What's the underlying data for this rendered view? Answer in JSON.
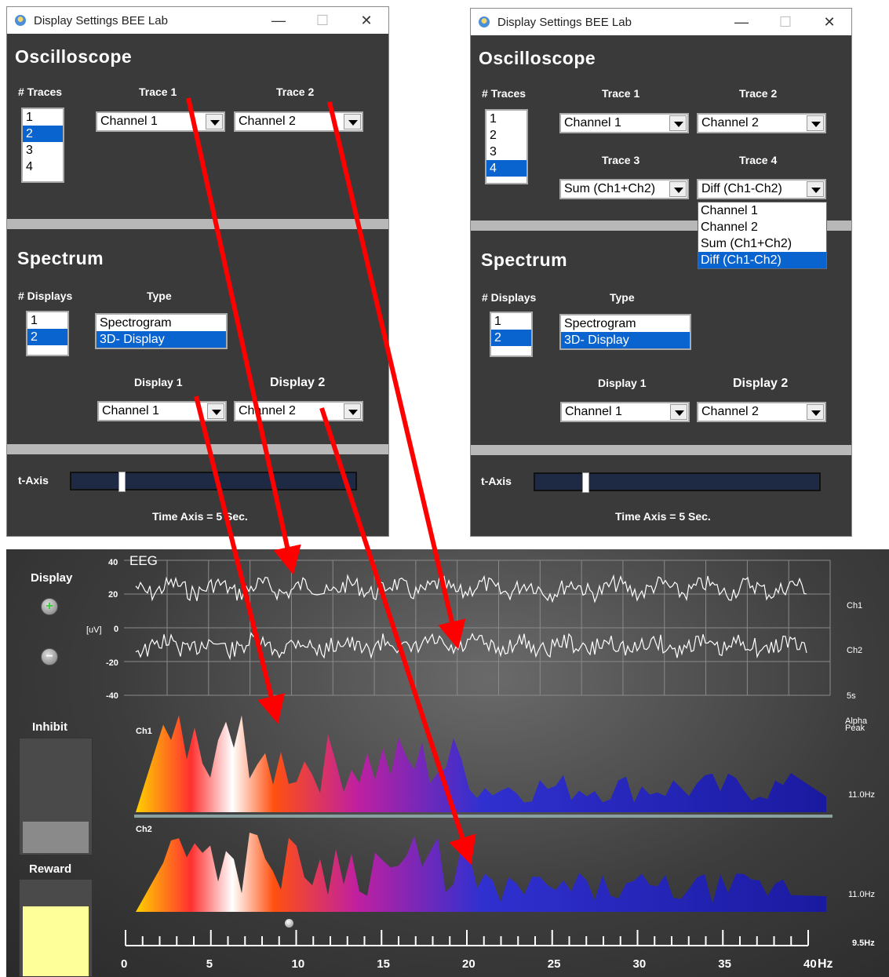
{
  "window_left": {
    "title": "Display Settings BEE Lab",
    "minimize": "—",
    "maximize": "☐",
    "close": "✕",
    "osc_heading": "Oscilloscope",
    "traces_label": "# Traces",
    "trace_options": [
      "1",
      "2",
      "3",
      "4"
    ],
    "traces_selected": "2",
    "trace1_label": "Trace 1",
    "trace1_value": "Channel 1",
    "trace2_label": "Trace 2",
    "trace2_value": "Channel 2",
    "spec_heading": "Spectrum",
    "displays_label": "# Displays",
    "display_options": [
      "1",
      "2"
    ],
    "displays_selected": "2",
    "type_label": "Type",
    "type_options": [
      "Spectrogram",
      "3D- Display"
    ],
    "type_selected": "3D- Display",
    "display1_label": "Display 1",
    "display1_value": "Channel 1",
    "display2_label": "Display 2",
    "display2_value": "Channel 2",
    "taxis_label": "t-Axis",
    "taxis_value": 0.17,
    "time_axis_text": "Time Axis =  5 Sec."
  },
  "window_right": {
    "title": "Display Settings BEE Lab",
    "minimize": "—",
    "maximize": "☐",
    "close": "✕",
    "osc_heading": "Oscilloscope",
    "traces_label": "# Traces",
    "trace_options": [
      "1",
      "2",
      "3",
      "4"
    ],
    "traces_selected": "4",
    "trace1_label": "Trace 1",
    "trace1_value": "Channel 1",
    "trace2_label": "Trace 2",
    "trace2_value": "Channel 2",
    "trace3_label": "Trace 3",
    "trace3_value": "Sum (Ch1+Ch2)",
    "trace4_label": "Trace 4",
    "trace4_value": "Diff (Ch1-Ch2)",
    "trace4_dropdown": [
      "Channel 1",
      "Channel 2",
      "Sum (Ch1+Ch2)",
      "Diff (Ch1-Ch2)"
    ],
    "trace4_dropdown_selected": "Diff (Ch1-Ch2)",
    "spec_heading": "Spectrum",
    "displays_label": "# Displays",
    "display_options": [
      "1",
      "2"
    ],
    "displays_selected": "2",
    "type_label": "Type",
    "type_options": [
      "Spectrogram",
      "3D- Display"
    ],
    "type_selected": "3D- Display",
    "display1_label": "Display 1",
    "display1_value": "Channel 1",
    "display2_label": "Display 2",
    "display2_value": "Channel 2",
    "taxis_label": "t-Axis",
    "taxis_value": 0.17,
    "time_axis_text": "Time Axis =  5 Sec."
  },
  "eeg": {
    "title": "EEG",
    "display_label": "Display",
    "plus": "+",
    "minus": "−",
    "inhibit_label": "Inhibit",
    "inhibit_level": 0.27,
    "reward_label": "Reward",
    "reward_level": 0.72,
    "y_ticks": [
      "40",
      "20",
      "0",
      "-20",
      "-40"
    ],
    "y_unit": "[uV]",
    "ch1_label": "Ch1",
    "ch2_label": "Ch2",
    "time_label": "5s",
    "alpha_peak_label": "Alpha Peak",
    "spec1_label": "Ch1",
    "spec2_label": "Ch2",
    "spec1_peak": "11.0Hz",
    "spec2_peak": "11.0Hz",
    "axis_peak": "9.5Hz",
    "freq_ticks": [
      "0",
      "5",
      "10",
      "15",
      "20",
      "25",
      "30",
      "35",
      "40"
    ],
    "freq_unit": "Hz",
    "colors": {
      "panel": "#3c3c3c",
      "arrow": "#ff0000",
      "reward": "#ffff99",
      "spectrum_low": "#1a1aa0",
      "spectrum_high": "#ffd000"
    }
  }
}
